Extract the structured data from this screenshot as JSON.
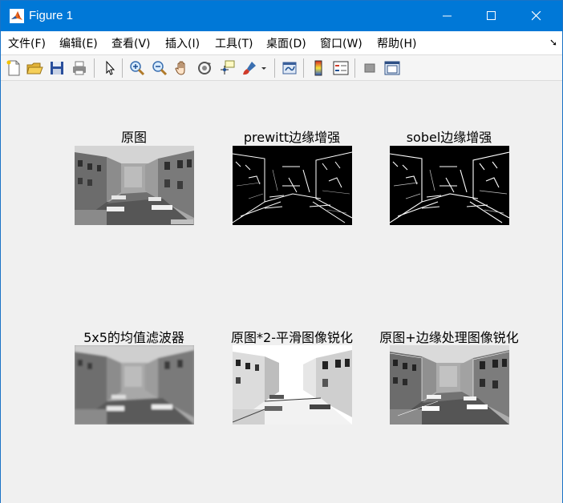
{
  "window": {
    "title": "Figure 1",
    "titlebar_color": "#0078d7"
  },
  "menu": {
    "items": [
      "文件(F)",
      "编辑(E)",
      "查看(V)",
      "插入(I)",
      "工具(T)",
      "桌面(D)",
      "窗口(W)",
      "帮助(H)"
    ],
    "overflow_icon": "dock-arrow-icon"
  },
  "toolbar": {
    "icons": [
      "new-figure-icon",
      "open-file-icon",
      "save-icon",
      "print-icon",
      "select-pointer-icon",
      "zoom-in-icon",
      "zoom-out-icon",
      "pan-hand-icon",
      "rotate-3d-icon",
      "data-cursor-icon",
      "brush-icon",
      "link-plot-icon",
      "colorbar-icon",
      "legend-icon",
      "hide-plot-tools-icon",
      "show-plot-tools-icon"
    ]
  },
  "subplots": [
    {
      "title": "原图",
      "style": "original"
    },
    {
      "title": "prewitt边缘增强",
      "style": "edges"
    },
    {
      "title": "sobel边缘增强",
      "style": "edges"
    },
    {
      "title": "5x5的均值滤波器",
      "style": "blurred"
    },
    {
      "title": "原图*2-平滑图像锐化",
      "style": "oversharp"
    },
    {
      "title": "原图+边缘处理图像锐化",
      "style": "sharpened"
    }
  ]
}
